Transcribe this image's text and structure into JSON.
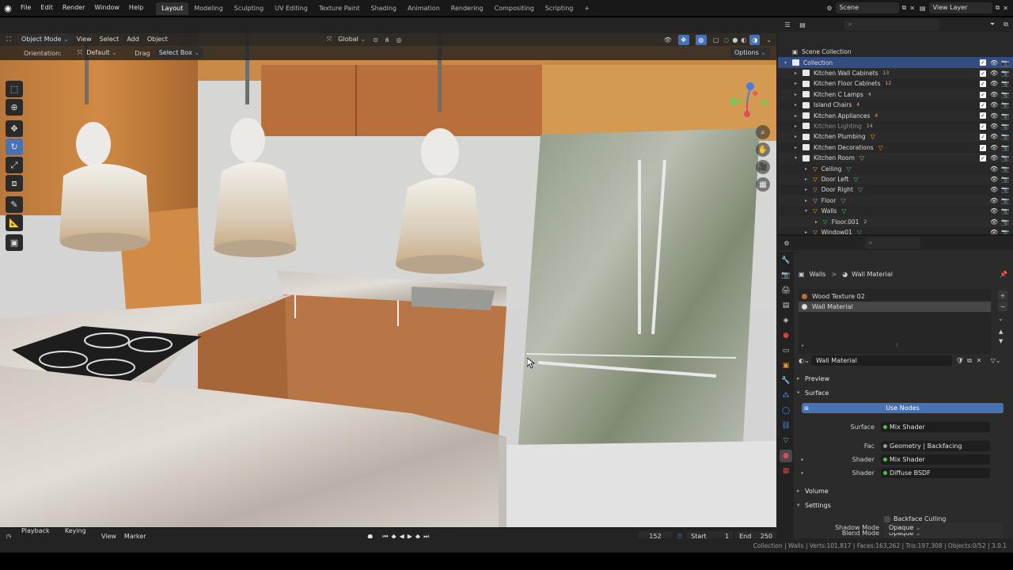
{
  "menu": {
    "items": [
      "File",
      "Edit",
      "Render",
      "Window",
      "Help"
    ],
    "workspaces": [
      "Layout",
      "Modeling",
      "Sculpting",
      "UV Editing",
      "Texture Paint",
      "Shading",
      "Animation",
      "Rendering",
      "Compositing",
      "Scripting"
    ],
    "active_workspace": "Layout",
    "add_tab": "+",
    "scene": "Scene",
    "view_layer": "View Layer"
  },
  "viewport": {
    "mode": "Object Mode",
    "menus": [
      "View",
      "Select",
      "Add",
      "Object"
    ],
    "transform": "Global",
    "orientation_label": "Orientation:",
    "orientation_value": "Default",
    "drag_label": "Drag",
    "drag_value": "Select Box",
    "options": "Options"
  },
  "timeline": {
    "menus": [
      "Playback",
      "Keying",
      "View",
      "Marker"
    ],
    "frame": "152",
    "start_label": "Start",
    "start": "1",
    "end_label": "End",
    "end": "250"
  },
  "outliner": {
    "scene_collection": "Scene Collection",
    "rows": [
      {
        "label": "Collection",
        "level": 0,
        "selected": true,
        "badge": ""
      },
      {
        "label": "Kitchen Wall Cabinets",
        "level": 1,
        "badge": "13"
      },
      {
        "label": "Kitchen Floor Cabinets",
        "level": 1,
        "badge": "12"
      },
      {
        "label": "Kitchen C Lamps",
        "level": 1,
        "badge": "4"
      },
      {
        "label": "Island Chairs",
        "level": 1,
        "badge": "4"
      },
      {
        "label": "Kitchen Appliances",
        "level": 1,
        "badge": "4"
      },
      {
        "label": "Kitchen Lighting",
        "level": 1,
        "badge": "14",
        "dim": true
      },
      {
        "label": "Kitchen Plumbing",
        "level": 1,
        "badge": ""
      },
      {
        "label": "Kitchen Decorations",
        "level": 1,
        "badge": ""
      },
      {
        "label": "Kitchen Room",
        "level": 1,
        "badge": ""
      },
      {
        "label": "Ceiling",
        "level": 2,
        "badge": ""
      },
      {
        "label": "Door Left",
        "level": 2,
        "badge": ""
      },
      {
        "label": "Door Right",
        "level": 2,
        "badge": ""
      },
      {
        "label": "Floor",
        "level": 2,
        "badge": ""
      },
      {
        "label": "Walls",
        "level": 2,
        "badge": ""
      },
      {
        "label": "Floor.001",
        "level": 3,
        "badge": "2"
      },
      {
        "label": "Window01",
        "level": 2,
        "badge": ""
      }
    ]
  },
  "properties": {
    "breadcrumb_object": "Walls",
    "breadcrumb_sep": ">",
    "breadcrumb_material": "Wall Material",
    "slots": [
      "Wood Texture 02",
      "Wall Material"
    ],
    "material_name": "Wall Material",
    "sections": {
      "preview": "Preview",
      "surface": "Surface",
      "volume": "Volume",
      "settings": "Settings"
    },
    "use_nodes": "Use Nodes",
    "surface_label": "Surface",
    "surface_value": "Mix Shader",
    "fac_label": "Fac",
    "fac_value": "Geometry | Backfacing",
    "shader1_label": "Shader",
    "shader1_value": "Mix Shader",
    "shader2_label": "Shader",
    "shader2_value": "Diffuse BSDF",
    "backface_culling": "Backface Culling",
    "blend_mode_label": "Blend Mode",
    "blend_mode_value": "Opaque",
    "shadow_mode_label": "Shadow Mode",
    "shadow_mode_value": "Opaque"
  },
  "status": "Collection | Walls | Verts:101,817 | Faces:163,262 | Tris:197,308 | Objects:0/52 | 3.0.1",
  "colors": {
    "accent": "#4772b3",
    "selection": "#334d80",
    "bg": "#232323"
  }
}
